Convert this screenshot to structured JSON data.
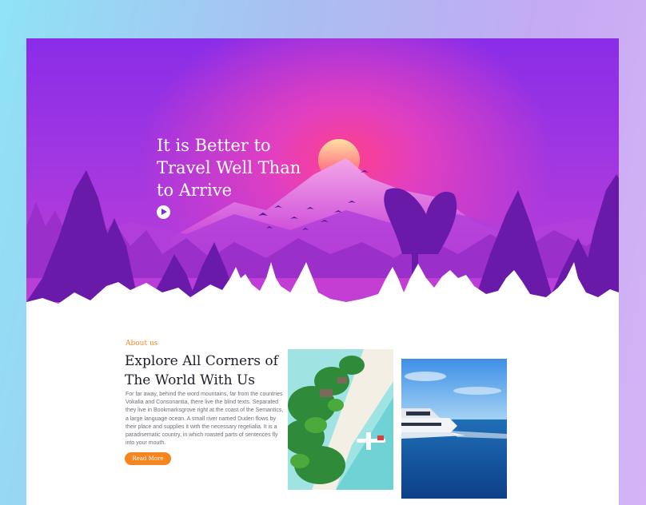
{
  "hero": {
    "title_lines": [
      "It is Better to",
      "Travel Well Than",
      "to Arrive"
    ],
    "play_icon": "play-icon"
  },
  "about": {
    "label": "About us",
    "heading_lines": [
      "Explore All Corners of",
      "The World With Us"
    ],
    "text": "For far away, behind the word mountains, far from the countries Vokalia and Consonantia, there live the blind texts. Separated they live in Bookmarksgrove right at the coast of the Semantics, a large language ocean. A small river named Duden flows by their place and supplies it with the necessary regelialia. It is a paradisematic country, in which roasted parts of sentences fly into your mouth.",
    "button_label": "Read More"
  },
  "colors": {
    "accent": "#f5861f",
    "hero_top": "#8a2de8",
    "hero_glow": "#ff3f8a",
    "heading": "#1e1e2a"
  }
}
